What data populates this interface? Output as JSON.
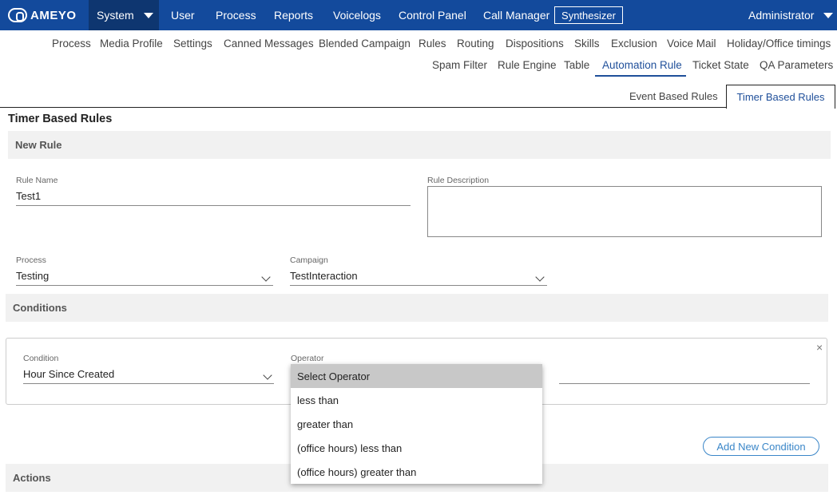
{
  "brand": {
    "logo_text": "AMEYO"
  },
  "topnav": {
    "system": "System",
    "items": [
      "User",
      "Process",
      "Reports",
      "Voicelogs",
      "Control Panel",
      "Call Manager"
    ],
    "synthesizer": "Synthesizer",
    "admin": "Administrator"
  },
  "subnav": {
    "row1": [
      "Process",
      "Media Profile",
      "Settings",
      "Canned Messages",
      "Blended Campaign",
      "Rules",
      "Routing",
      "Dispositions",
      "Skills",
      "Exclusion",
      "Voice Mail",
      "Holiday/Office timings"
    ],
    "row2": [
      "Spam Filter",
      "Rule Engine",
      "Table",
      "Automation Rule",
      "Ticket State",
      "QA Parameters"
    ]
  },
  "tabs": {
    "event": "Event Based Rules",
    "timer": "Timer Based Rules"
  },
  "page_title": "Timer Based Rules",
  "new_rule": {
    "heading": "New Rule",
    "rule_name_label": "Rule Name",
    "rule_name_value": "Test1",
    "rule_desc_label": "Rule Description",
    "process_label": "Process",
    "process_value": "Testing",
    "campaign_label": "Campaign",
    "campaign_value": "TestInteraction"
  },
  "conditions": {
    "heading": "Conditions",
    "condition_label": "Condition",
    "condition_value": "Hour Since Created",
    "operator_label": "Operator",
    "operator_options": [
      "Select Operator",
      "less than",
      "greater than",
      "(office hours) less than",
      "(office hours) greater than"
    ],
    "add_button": "Add New Condition",
    "close_glyph": "×"
  },
  "actions": {
    "heading": "Actions"
  },
  "colors": {
    "nav_bg": "#134a9c",
    "accent": "#1f4f9a",
    "button": "#3a86c8"
  }
}
